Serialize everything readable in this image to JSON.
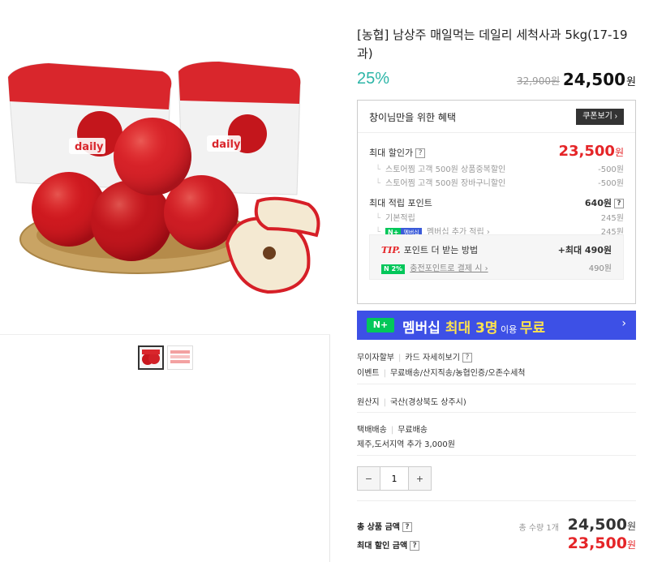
{
  "product": {
    "title": "[농협] 남상주 매일먹는 데일리 세척사과 5kg(17-19과)",
    "discount_rate": "25%",
    "original_price": "32,900원",
    "sale_price": "24,500",
    "currency": "원"
  },
  "image": {
    "bag_label": "daily"
  },
  "benefits": {
    "title": "창이님만을 위한 혜택",
    "coupon_button": "쿠폰보기 ›",
    "max_discount_label": "최대 할인가",
    "max_discount_value": "23,500",
    "discount_items": [
      {
        "label": "스토어찜 고객 500원 상품중복할인",
        "value": "-500원"
      },
      {
        "label": "스토어찜 고객 500원 장바구니할인",
        "value": "-500원"
      }
    ],
    "max_points_label": "최대 적립 포인트",
    "max_points_value": "640원",
    "point_items": [
      {
        "label": "기본적립",
        "value": "245원"
      },
      {
        "label": "멤버십 추가 적립 ›",
        "value": "245원",
        "badge_n": "N+",
        "badge_m": "멤버십"
      }
    ],
    "tip_label": "TIP.",
    "tip_text": "포인트 더 받는 방법",
    "tip_value": "+최대 490원",
    "charge_badge": "N 2%",
    "charge_text": "충전포인트로 결제 시 ›",
    "charge_value": "490원",
    "help_mark": "?"
  },
  "banner": {
    "logo": "N+",
    "text_a": "멤버십 ",
    "text_b": "최대 3명",
    "text_c": " 이용 ",
    "text_d": "무료",
    "chevron": "›"
  },
  "info": {
    "installment": "무이자할부",
    "card_detail": "카드 자세히보기",
    "event_label": "이벤트",
    "event_value": "무료배송/산지직송/농협인증/오존수세척",
    "origin_label": "원산지",
    "origin_value": "국산(경상북도 상주시)",
    "delivery_label": "택배배송",
    "delivery_value": "무료배송",
    "delivery_extra": "제주,도서지역 추가 3,000원"
  },
  "quantity": {
    "minus": "−",
    "value": "1",
    "plus": "+"
  },
  "totals": {
    "total_label": "총 상품 금액",
    "count_text": "총 수량 1개",
    "total_value": "24,500",
    "discount_label": "최대 할인 금액",
    "discount_value": "23,500"
  },
  "colors": {
    "discount_rate": "#2cb5a7",
    "highlight_red": "#e52528",
    "naver_green": "#03c75a",
    "banner_blue": "#3d50e6"
  }
}
